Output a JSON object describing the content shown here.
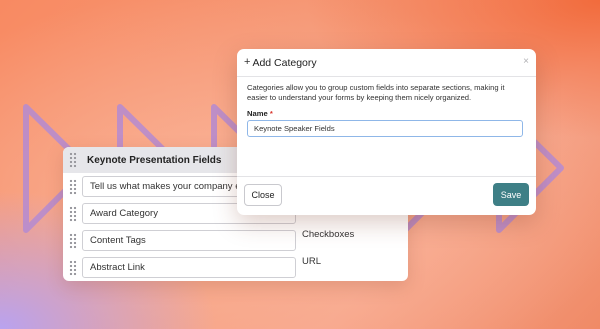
{
  "colors": {
    "accent_button": "#3e7f86",
    "chevron_stroke": "#b58bd2",
    "required_mark": "#d9342b",
    "input_focus_border": "#8fb7e8"
  },
  "field_list": {
    "title": "Keynote Presentation Fields",
    "rows": [
      {
        "label": "Tell us what makes your company exciting",
        "type": ""
      },
      {
        "label": "Award Category",
        "type": ""
      },
      {
        "label": "Content Tags",
        "type": "Checkboxes"
      },
      {
        "label": "Abstract Link",
        "type": "URL"
      }
    ]
  },
  "modal": {
    "plus_icon": "+",
    "title": "Add Category",
    "close_icon": "×",
    "description": "Categories allow you to group custom fields into separate sections, making it easier to understand your forms by keeping them nicely organized.",
    "name_label": "Name",
    "required_mark": "*",
    "name_value": "Keynote Speaker Fields",
    "close_button": "Close",
    "save_button": "Save"
  }
}
